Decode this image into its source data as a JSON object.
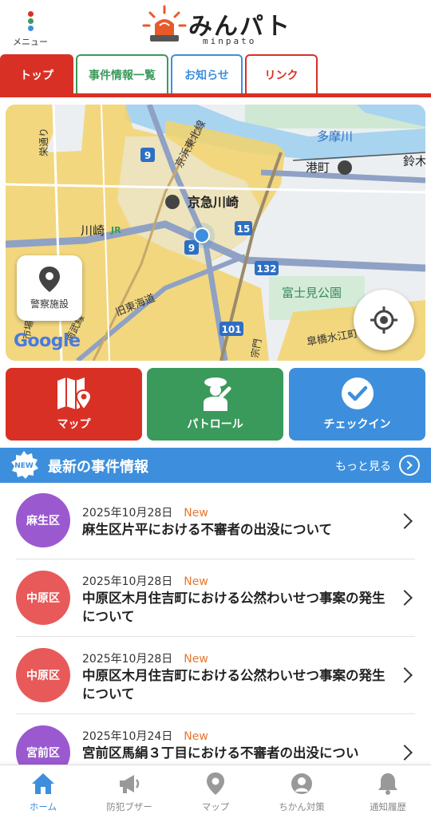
{
  "header": {
    "menu_label": "メニュー",
    "logo_title": "みんパト",
    "logo_sub": "minpato"
  },
  "tabs": [
    {
      "label": "トップ",
      "color": "#d93025",
      "active": true
    },
    {
      "label": "事件情報一覧",
      "color": "#3a9a5b",
      "active": false
    },
    {
      "label": "お知らせ",
      "color": "#3d8fdd",
      "active": false
    },
    {
      "label": "リンク",
      "color": "#d93025",
      "active": false
    }
  ],
  "map": {
    "labels": {
      "tamagawa": "多摩川",
      "minatocho": "港町",
      "suzuki": "鈴木",
      "keikyu": "京急川崎",
      "kawasaki": "川崎",
      "jr": "JR",
      "fujimi": "富士見公園",
      "kyuto": "旧東海道",
      "keihin": "京浜東北線",
      "sakae": "栄通り",
      "ichiba": "市場",
      "nanbu": "南武線",
      "kanmon": "宗門",
      "suikou": "皐橋水江町線",
      "r9a": "9",
      "r9b": "9",
      "r15": "15",
      "r132": "132",
      "r101": "101"
    },
    "police_label": "警察施設",
    "google": "Google"
  },
  "actions": [
    {
      "label": "マップ",
      "color": "#d93025",
      "icon": "map-pin-icon"
    },
    {
      "label": "パトロール",
      "color": "#3a9a5b",
      "icon": "patrol-officer-icon"
    },
    {
      "label": "チェックイン",
      "color": "#3d8fdd",
      "icon": "check-circle-icon"
    }
  ],
  "news_section": {
    "badge": "NEW",
    "title": "最新の事件情報",
    "more": "もっと見る"
  },
  "news": [
    {
      "area": "麻生区",
      "area_color": "#9b59d0",
      "date": "2025年10月28日",
      "tag": "New",
      "title": "麻生区片平における不審者の出没について"
    },
    {
      "area": "中原区",
      "area_color": "#e85a5a",
      "date": "2025年10月28日",
      "tag": "New",
      "title": "中原区木月住吉町における公然わいせつ事案の発生について"
    },
    {
      "area": "中原区",
      "area_color": "#e85a5a",
      "date": "2025年10月28日",
      "tag": "New",
      "title": "中原区木月住吉町における公然わいせつ事案の発生について"
    },
    {
      "area": "宮前区",
      "area_color": "#9b59d0",
      "date": "2025年10月24日",
      "tag": "New",
      "title": "宮前区馬絹３丁目における不審者の出没につい"
    }
  ],
  "bottom_nav": [
    {
      "label": "ホーム",
      "icon": "home-icon",
      "active": true
    },
    {
      "label": "防犯ブザー",
      "icon": "megaphone-icon",
      "active": false
    },
    {
      "label": "マップ",
      "icon": "map-marker-icon",
      "active": false
    },
    {
      "label": "ちかん対策",
      "icon": "molester-guard-icon",
      "active": false
    },
    {
      "label": "通知履歴",
      "icon": "bell-icon",
      "active": false
    }
  ]
}
